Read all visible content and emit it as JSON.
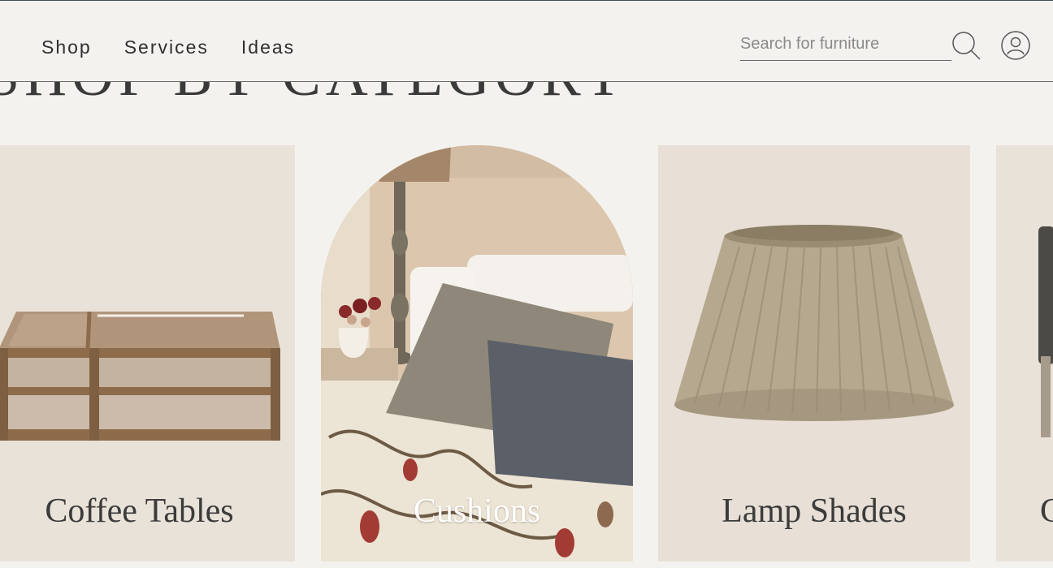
{
  "nav": {
    "items": [
      {
        "label": "Shop"
      },
      {
        "label": "Services"
      },
      {
        "label": "Ideas"
      }
    ]
  },
  "search": {
    "placeholder": "Search for furniture",
    "icon": "search-icon"
  },
  "account": {
    "icon": "user-icon"
  },
  "section": {
    "title": "SHOP BY CATEGORY"
  },
  "categories": [
    {
      "label": "Coffee Tables",
      "image": "coffee-table-image"
    },
    {
      "label": "Cushions",
      "image": "cushions-bed-image"
    },
    {
      "label": "Lamp Shades",
      "image": "lamp-shade-image"
    },
    {
      "label": "C",
      "image": "chair-image"
    }
  ],
  "colors": {
    "background": "#f4f2ee",
    "card": "#e9e2d9",
    "text": "#3b3b3b",
    "header_border": "#3d4e52"
  }
}
